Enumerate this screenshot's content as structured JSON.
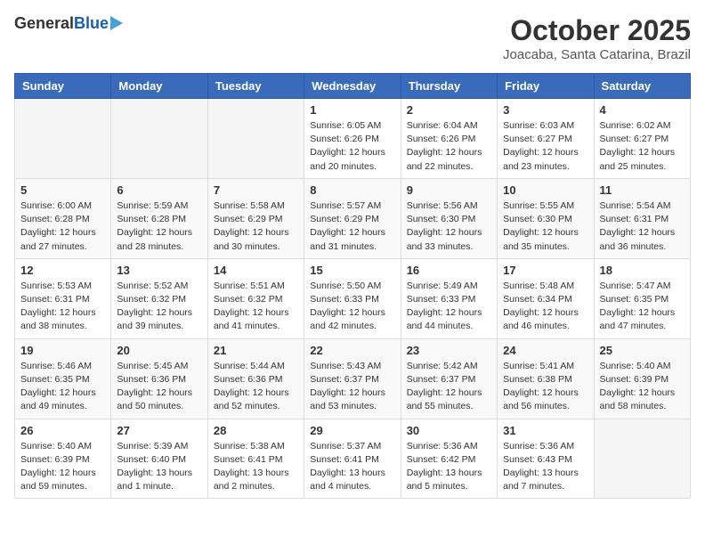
{
  "header": {
    "logo_general": "General",
    "logo_blue": "Blue",
    "month_title": "October 2025",
    "location": "Joacaba, Santa Catarina, Brazil"
  },
  "weekdays": [
    "Sunday",
    "Monday",
    "Tuesday",
    "Wednesday",
    "Thursday",
    "Friday",
    "Saturday"
  ],
  "weeks": [
    [
      {
        "day": "",
        "info": ""
      },
      {
        "day": "",
        "info": ""
      },
      {
        "day": "",
        "info": ""
      },
      {
        "day": "1",
        "info": "Sunrise: 6:05 AM\nSunset: 6:26 PM\nDaylight: 12 hours\nand 20 minutes."
      },
      {
        "day": "2",
        "info": "Sunrise: 6:04 AM\nSunset: 6:26 PM\nDaylight: 12 hours\nand 22 minutes."
      },
      {
        "day": "3",
        "info": "Sunrise: 6:03 AM\nSunset: 6:27 PM\nDaylight: 12 hours\nand 23 minutes."
      },
      {
        "day": "4",
        "info": "Sunrise: 6:02 AM\nSunset: 6:27 PM\nDaylight: 12 hours\nand 25 minutes."
      }
    ],
    [
      {
        "day": "5",
        "info": "Sunrise: 6:00 AM\nSunset: 6:28 PM\nDaylight: 12 hours\nand 27 minutes."
      },
      {
        "day": "6",
        "info": "Sunrise: 5:59 AM\nSunset: 6:28 PM\nDaylight: 12 hours\nand 28 minutes."
      },
      {
        "day": "7",
        "info": "Sunrise: 5:58 AM\nSunset: 6:29 PM\nDaylight: 12 hours\nand 30 minutes."
      },
      {
        "day": "8",
        "info": "Sunrise: 5:57 AM\nSunset: 6:29 PM\nDaylight: 12 hours\nand 31 minutes."
      },
      {
        "day": "9",
        "info": "Sunrise: 5:56 AM\nSunset: 6:30 PM\nDaylight: 12 hours\nand 33 minutes."
      },
      {
        "day": "10",
        "info": "Sunrise: 5:55 AM\nSunset: 6:30 PM\nDaylight: 12 hours\nand 35 minutes."
      },
      {
        "day": "11",
        "info": "Sunrise: 5:54 AM\nSunset: 6:31 PM\nDaylight: 12 hours\nand 36 minutes."
      }
    ],
    [
      {
        "day": "12",
        "info": "Sunrise: 5:53 AM\nSunset: 6:31 PM\nDaylight: 12 hours\nand 38 minutes."
      },
      {
        "day": "13",
        "info": "Sunrise: 5:52 AM\nSunset: 6:32 PM\nDaylight: 12 hours\nand 39 minutes."
      },
      {
        "day": "14",
        "info": "Sunrise: 5:51 AM\nSunset: 6:32 PM\nDaylight: 12 hours\nand 41 minutes."
      },
      {
        "day": "15",
        "info": "Sunrise: 5:50 AM\nSunset: 6:33 PM\nDaylight: 12 hours\nand 42 minutes."
      },
      {
        "day": "16",
        "info": "Sunrise: 5:49 AM\nSunset: 6:33 PM\nDaylight: 12 hours\nand 44 minutes."
      },
      {
        "day": "17",
        "info": "Sunrise: 5:48 AM\nSunset: 6:34 PM\nDaylight: 12 hours\nand 46 minutes."
      },
      {
        "day": "18",
        "info": "Sunrise: 5:47 AM\nSunset: 6:35 PM\nDaylight: 12 hours\nand 47 minutes."
      }
    ],
    [
      {
        "day": "19",
        "info": "Sunrise: 5:46 AM\nSunset: 6:35 PM\nDaylight: 12 hours\nand 49 minutes."
      },
      {
        "day": "20",
        "info": "Sunrise: 5:45 AM\nSunset: 6:36 PM\nDaylight: 12 hours\nand 50 minutes."
      },
      {
        "day": "21",
        "info": "Sunrise: 5:44 AM\nSunset: 6:36 PM\nDaylight: 12 hours\nand 52 minutes."
      },
      {
        "day": "22",
        "info": "Sunrise: 5:43 AM\nSunset: 6:37 PM\nDaylight: 12 hours\nand 53 minutes."
      },
      {
        "day": "23",
        "info": "Sunrise: 5:42 AM\nSunset: 6:37 PM\nDaylight: 12 hours\nand 55 minutes."
      },
      {
        "day": "24",
        "info": "Sunrise: 5:41 AM\nSunset: 6:38 PM\nDaylight: 12 hours\nand 56 minutes."
      },
      {
        "day": "25",
        "info": "Sunrise: 5:40 AM\nSunset: 6:39 PM\nDaylight: 12 hours\nand 58 minutes."
      }
    ],
    [
      {
        "day": "26",
        "info": "Sunrise: 5:40 AM\nSunset: 6:39 PM\nDaylight: 12 hours\nand 59 minutes."
      },
      {
        "day": "27",
        "info": "Sunrise: 5:39 AM\nSunset: 6:40 PM\nDaylight: 13 hours\nand 1 minute."
      },
      {
        "day": "28",
        "info": "Sunrise: 5:38 AM\nSunset: 6:41 PM\nDaylight: 13 hours\nand 2 minutes."
      },
      {
        "day": "29",
        "info": "Sunrise: 5:37 AM\nSunset: 6:41 PM\nDaylight: 13 hours\nand 4 minutes."
      },
      {
        "day": "30",
        "info": "Sunrise: 5:36 AM\nSunset: 6:42 PM\nDaylight: 13 hours\nand 5 minutes."
      },
      {
        "day": "31",
        "info": "Sunrise: 5:36 AM\nSunset: 6:43 PM\nDaylight: 13 hours\nand 7 minutes."
      },
      {
        "day": "",
        "info": ""
      }
    ]
  ]
}
